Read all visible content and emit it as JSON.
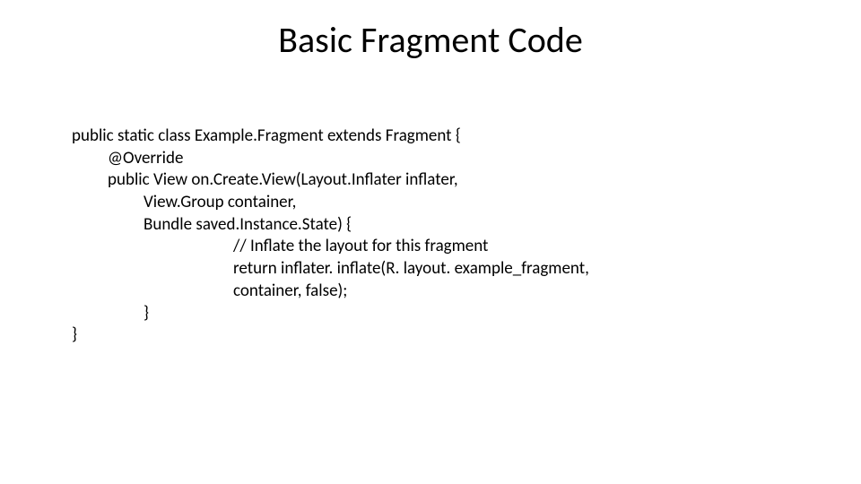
{
  "title": "Basic Fragment Code",
  "code": {
    "l0": "public static class Example.Fragment extends Fragment {",
    "l1": "@Override",
    "l2": "public View on.Create.View(Layout.Inflater inflater,",
    "l3": "View.Group container,",
    "l4": "Bundle saved.Instance.State) {",
    "l5": "// Inflate the layout for this fragment",
    "l6": "return inflater. inflate(R. layout. example_fragment,",
    "l7": "container, false);",
    "l8": "}",
    "l9": "}"
  }
}
